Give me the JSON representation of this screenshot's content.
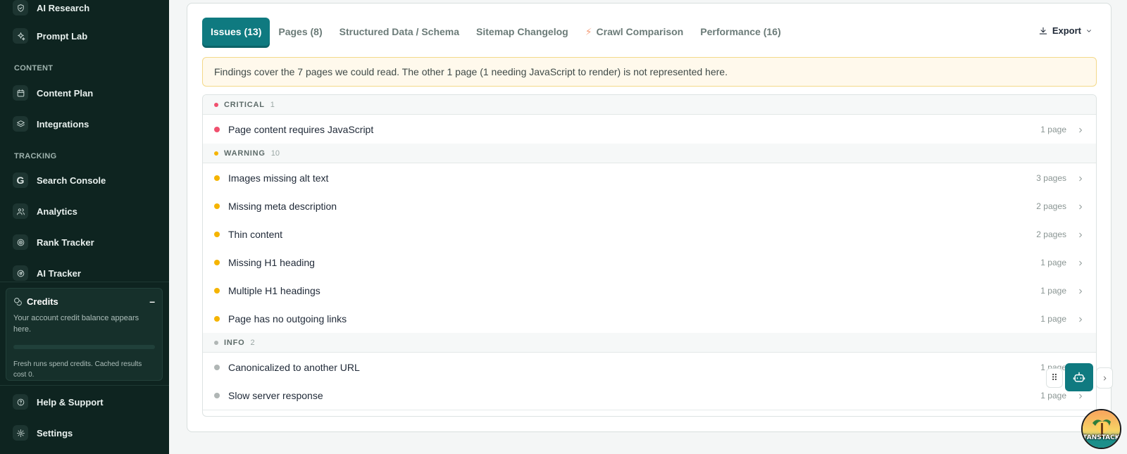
{
  "sidebar": {
    "top_items": [
      {
        "label": "AI Research",
        "icon": "shield-icon"
      },
      {
        "label": "Prompt Lab",
        "icon": "sparkles-icon"
      }
    ],
    "sections": [
      {
        "title": "CONTENT",
        "items": [
          {
            "label": "Content Plan",
            "icon": "calendar-icon"
          },
          {
            "label": "Integrations",
            "icon": "layers-icon"
          }
        ]
      },
      {
        "title": "TRACKING",
        "items": [
          {
            "label": "Search Console",
            "icon": "google-icon"
          },
          {
            "label": "Analytics",
            "icon": "users-icon"
          },
          {
            "label": "Rank Tracker",
            "icon": "target-icon"
          },
          {
            "label": "AI Tracker",
            "icon": "radar-icon"
          }
        ]
      }
    ],
    "credits": {
      "title": "Credits",
      "collapse_label": "–",
      "description": "Your account credit balance appears here.",
      "progress": 0.0,
      "note": "Fresh runs spend credits. Cached results cost 0."
    },
    "bottom_items": [
      {
        "label": "Help & Support",
        "icon": "help-icon"
      },
      {
        "label": "Settings",
        "icon": "gear-icon"
      }
    ]
  },
  "tabs": [
    {
      "label": "Issues (13)",
      "active": true
    },
    {
      "label": "Pages (8)",
      "active": false
    },
    {
      "label": "Structured Data / Schema",
      "active": false
    },
    {
      "label": "Sitemap Changelog",
      "active": false
    },
    {
      "label": "Crawl Comparison",
      "active": false,
      "icon": "bolt-icon"
    },
    {
      "label": "Performance (16)",
      "active": false
    }
  ],
  "export_label": "Export",
  "notice": "Findings cover the 7 pages we could read. The other 1 page (1 needing JavaScript to render) is not represented here.",
  "issue_groups": [
    {
      "severity": "CRITICAL",
      "count": "1",
      "color": "#f0506e",
      "items": [
        {
          "title": "Page content requires JavaScript",
          "pages": "1 page"
        }
      ]
    },
    {
      "severity": "WARNING",
      "count": "10",
      "color": "#f5b400",
      "items": [
        {
          "title": "Images missing alt text",
          "pages": "3 pages"
        },
        {
          "title": "Missing meta description",
          "pages": "2 pages"
        },
        {
          "title": "Thin content",
          "pages": "2 pages"
        },
        {
          "title": "Missing H1 heading",
          "pages": "1 page"
        },
        {
          "title": "Multiple H1 headings",
          "pages": "1 page"
        },
        {
          "title": "Page has no outgoing links",
          "pages": "1 page"
        }
      ]
    },
    {
      "severity": "INFO",
      "count": "2",
      "color": "#b0b6b5",
      "items": [
        {
          "title": "Canonicalized to another URL",
          "pages": "1 page"
        },
        {
          "title": "Slow server response",
          "pages": "1 page"
        }
      ]
    }
  ],
  "floating": {
    "handle_icon": "drag-handle-icon",
    "bot_icon": "bot-icon",
    "next_icon": "chevron-right-icon"
  },
  "tanstack_badge": "TANSTACK",
  "colors": {
    "accent": "#0f7a80",
    "sidebar_bg": "#0e2420",
    "critical": "#f0506e",
    "warning": "#f5b400",
    "info": "#b0b6b5"
  }
}
